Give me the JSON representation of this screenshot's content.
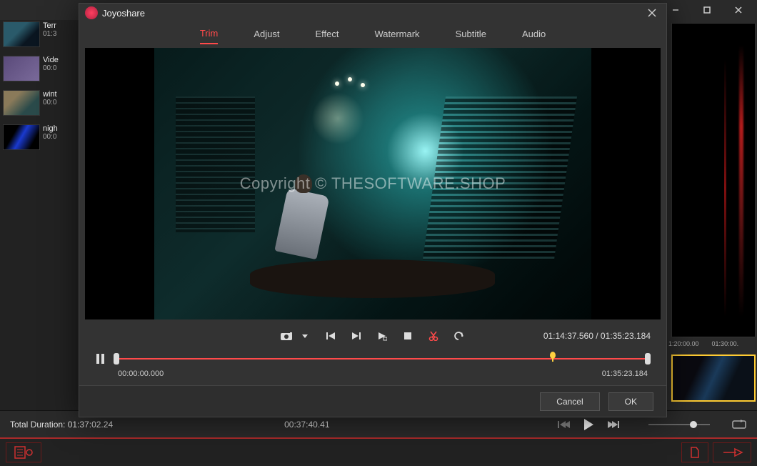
{
  "window": {
    "brand": "Joyoshare"
  },
  "clips": [
    {
      "name": "Terr",
      "time": "01:3"
    },
    {
      "name": "Vide",
      "time": "00:0"
    },
    {
      "name": "wint",
      "time": "00:0"
    },
    {
      "name": "nigh",
      "time": "00:0"
    }
  ],
  "tabs": [
    {
      "label": "Trim",
      "active": true
    },
    {
      "label": "Adjust",
      "active": false
    },
    {
      "label": "Effect",
      "active": false
    },
    {
      "label": "Watermark",
      "active": false
    },
    {
      "label": "Subtitle",
      "active": false
    },
    {
      "label": "Audio",
      "active": false
    }
  ],
  "preview": {
    "watermark": "Copyright © THESOFTWARE.SHOP"
  },
  "player": {
    "current": "01:14:37.560",
    "total": "01:35:23.184",
    "sep": " / ",
    "start": "00:00:00.000",
    "end": "01:35:23.184"
  },
  "buttons": {
    "cancel": "Cancel",
    "ok": "OK"
  },
  "status": {
    "total_duration_label": "Total Duration: ",
    "total_duration": "01:37:02.24",
    "current_time": "00:37:40.41"
  },
  "timeline": {
    "tick1": "1:20:00.00",
    "tick2": "01:30:00."
  }
}
